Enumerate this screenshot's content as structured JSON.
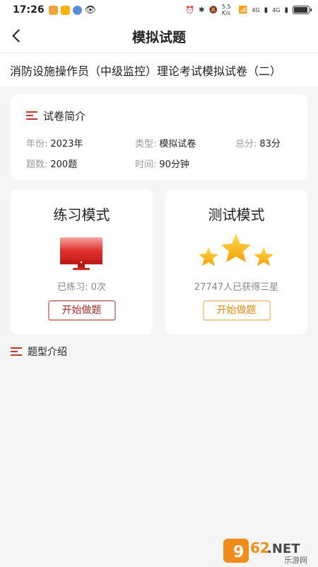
{
  "status_bar": {
    "time": "17:26",
    "network_speed": "5.5 K/s",
    "signal_a": "4G",
    "signal_b": "4G",
    "battery_level": 0.85
  },
  "nav": {
    "back_icon": "chevron-left-icon",
    "title": "模拟试题"
  },
  "exam_title": "消防设施操作员（中级监控）理论考试模拟试卷（二）",
  "intro": {
    "heading": "试卷简介",
    "year_label": "年份:",
    "year_value": "2023年",
    "type_label": "类型:",
    "type_value": "模拟试卷",
    "score_label": "总分:",
    "score_value": "83分",
    "count_label": "题数:",
    "count_value": "200题",
    "time_label": "时间:",
    "time_value": "90分钟"
  },
  "practice": {
    "title": "练习模式",
    "icon": "monitor-icon",
    "stat": "已练习: 0次",
    "button": "开始做题"
  },
  "test": {
    "title": "测试模式",
    "icon": "stars-icon",
    "stat": "27747人已获得三星",
    "button": "开始做题"
  },
  "types_heading": "题型介绍",
  "watermark": {
    "brand": "962.NET",
    "sub": "乐游网"
  },
  "colors": {
    "accent_red": "#c0392b",
    "accent_orange": "#e8a33b",
    "background": "#f5f5f5"
  }
}
